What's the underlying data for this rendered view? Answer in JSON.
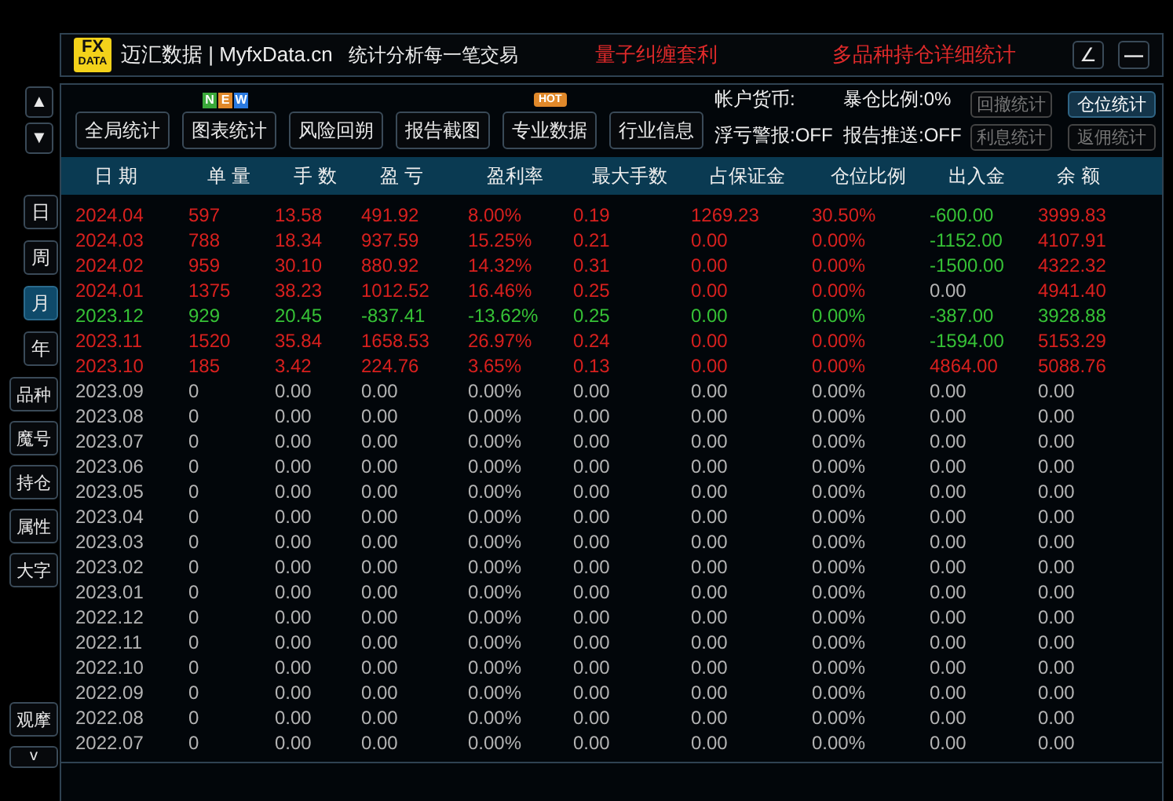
{
  "title_bar": {
    "logo": [
      "FX",
      "DATA"
    ],
    "brand": "迈汇数据 | MyfxData.cn",
    "slogan": "统计分析每一笔交易",
    "links": [
      "量子纠缠套利",
      "多品种持仓详细统计"
    ],
    "buttons": [
      "∠",
      "—"
    ]
  },
  "scroll_buttons": [
    "▲",
    "▼"
  ],
  "side_buttons": [
    {
      "label": "日",
      "selected": false
    },
    {
      "label": "周",
      "selected": false
    },
    {
      "label": "月",
      "selected": true
    },
    {
      "label": "年",
      "selected": false
    }
  ],
  "side_tools": [
    "品种",
    "魔号",
    "持仓",
    "属性",
    "大字"
  ],
  "side_bottom": [
    "观摩",
    "v"
  ],
  "toolbar": {
    "buttons": [
      {
        "label": "全局统计"
      },
      {
        "label": "图表统计",
        "badge": {
          "kind": "new",
          "letters": [
            "N",
            "E",
            "W"
          ]
        }
      },
      {
        "label": "风险回朔"
      },
      {
        "label": "报告截图"
      },
      {
        "label": "专业数据",
        "badge": {
          "kind": "hot",
          "text": "HOT"
        }
      },
      {
        "label": "行业信息"
      }
    ],
    "info": [
      "帐户货币:",
      "暴仓比例:0%",
      "浮亏警报:OFF",
      "报告推送:OFF"
    ],
    "stat_buttons": [
      {
        "label": "回撤统计",
        "selected": false
      },
      {
        "label": "仓位统计",
        "selected": true
      },
      {
        "label": "利息统计",
        "selected": false
      },
      {
        "label": "返佣统计",
        "selected": false
      }
    ]
  },
  "table": {
    "columns": [
      "日 期",
      "单 量",
      "手 数",
      "盈 亏",
      "盈利率",
      "最大手数",
      "占保证金",
      "仓位比例",
      "出入金",
      "余 额"
    ],
    "rows": [
      {
        "kind": "gain",
        "cells": [
          "2024.04",
          "597",
          "13.58",
          "491.92",
          "8.00%",
          "0.19",
          "1269.23",
          "30.50%"
        ],
        "cash": {
          "kind": "out",
          "text": "-600.00"
        },
        "balance": "3999.83"
      },
      {
        "kind": "gain",
        "cells": [
          "2024.03",
          "788",
          "18.34",
          "937.59",
          "15.25%",
          "0.21",
          "0.00",
          "0.00%"
        ],
        "cash": {
          "kind": "out",
          "text": "-1152.00"
        },
        "balance": "4107.91"
      },
      {
        "kind": "gain",
        "cells": [
          "2024.02",
          "959",
          "30.10",
          "880.92",
          "14.32%",
          "0.31",
          "0.00",
          "0.00%"
        ],
        "cash": {
          "kind": "out",
          "text": "-1500.00"
        },
        "balance": "4322.32"
      },
      {
        "kind": "gain",
        "cells": [
          "2024.01",
          "1375",
          "38.23",
          "1012.52",
          "16.46%",
          "0.25",
          "0.00",
          "0.00%"
        ],
        "cash": {
          "kind": "none",
          "text": "0.00"
        },
        "balance": "4941.40"
      },
      {
        "kind": "loss",
        "cells": [
          "2023.12",
          "929",
          "20.45",
          "-837.41",
          "-13.62%",
          "0.25",
          "0.00",
          "0.00%"
        ],
        "cash": {
          "kind": "out",
          "text": "-387.00"
        },
        "balance": "3928.88"
      },
      {
        "kind": "gain",
        "cells": [
          "2023.11",
          "1520",
          "35.84",
          "1658.53",
          "26.97%",
          "0.24",
          "0.00",
          "0.00%"
        ],
        "cash": {
          "kind": "out",
          "text": "-1594.00"
        },
        "balance": "5153.29"
      },
      {
        "kind": "gain",
        "cells": [
          "2023.10",
          "185",
          "3.42",
          "224.76",
          "3.65%",
          "0.13",
          "0.00",
          "0.00%"
        ],
        "cash": {
          "kind": "in",
          "text": "4864.00"
        },
        "balance": "5088.76"
      },
      {
        "kind": "empty",
        "cells": [
          "2023.09",
          "0",
          "0.00",
          "0.00",
          "0.00%",
          "0.00",
          "0.00",
          "0.00%"
        ],
        "cash": {
          "kind": "none",
          "text": "0.00"
        },
        "balance": "0.00"
      },
      {
        "kind": "empty",
        "cells": [
          "2023.08",
          "0",
          "0.00",
          "0.00",
          "0.00%",
          "0.00",
          "0.00",
          "0.00%"
        ],
        "cash": {
          "kind": "none",
          "text": "0.00"
        },
        "balance": "0.00"
      },
      {
        "kind": "empty",
        "cells": [
          "2023.07",
          "0",
          "0.00",
          "0.00",
          "0.00%",
          "0.00",
          "0.00",
          "0.00%"
        ],
        "cash": {
          "kind": "none",
          "text": "0.00"
        },
        "balance": "0.00"
      },
      {
        "kind": "empty",
        "cells": [
          "2023.06",
          "0",
          "0.00",
          "0.00",
          "0.00%",
          "0.00",
          "0.00",
          "0.00%"
        ],
        "cash": {
          "kind": "none",
          "text": "0.00"
        },
        "balance": "0.00"
      },
      {
        "kind": "empty",
        "cells": [
          "2023.05",
          "0",
          "0.00",
          "0.00",
          "0.00%",
          "0.00",
          "0.00",
          "0.00%"
        ],
        "cash": {
          "kind": "none",
          "text": "0.00"
        },
        "balance": "0.00"
      },
      {
        "kind": "empty",
        "cells": [
          "2023.04",
          "0",
          "0.00",
          "0.00",
          "0.00%",
          "0.00",
          "0.00",
          "0.00%"
        ],
        "cash": {
          "kind": "none",
          "text": "0.00"
        },
        "balance": "0.00"
      },
      {
        "kind": "empty",
        "cells": [
          "2023.03",
          "0",
          "0.00",
          "0.00",
          "0.00%",
          "0.00",
          "0.00",
          "0.00%"
        ],
        "cash": {
          "kind": "none",
          "text": "0.00"
        },
        "balance": "0.00"
      },
      {
        "kind": "empty",
        "cells": [
          "2023.02",
          "0",
          "0.00",
          "0.00",
          "0.00%",
          "0.00",
          "0.00",
          "0.00%"
        ],
        "cash": {
          "kind": "none",
          "text": "0.00"
        },
        "balance": "0.00"
      },
      {
        "kind": "empty",
        "cells": [
          "2023.01",
          "0",
          "0.00",
          "0.00",
          "0.00%",
          "0.00",
          "0.00",
          "0.00%"
        ],
        "cash": {
          "kind": "none",
          "text": "0.00"
        },
        "balance": "0.00"
      },
      {
        "kind": "empty",
        "cells": [
          "2022.12",
          "0",
          "0.00",
          "0.00",
          "0.00%",
          "0.00",
          "0.00",
          "0.00%"
        ],
        "cash": {
          "kind": "none",
          "text": "0.00"
        },
        "balance": "0.00"
      },
      {
        "kind": "empty",
        "cells": [
          "2022.11",
          "0",
          "0.00",
          "0.00",
          "0.00%",
          "0.00",
          "0.00",
          "0.00%"
        ],
        "cash": {
          "kind": "none",
          "text": "0.00"
        },
        "balance": "0.00"
      },
      {
        "kind": "empty",
        "cells": [
          "2022.10",
          "0",
          "0.00",
          "0.00",
          "0.00%",
          "0.00",
          "0.00",
          "0.00%"
        ],
        "cash": {
          "kind": "none",
          "text": "0.00"
        },
        "balance": "0.00"
      },
      {
        "kind": "empty",
        "cells": [
          "2022.09",
          "0",
          "0.00",
          "0.00",
          "0.00%",
          "0.00",
          "0.00",
          "0.00%"
        ],
        "cash": {
          "kind": "none",
          "text": "0.00"
        },
        "balance": "0.00"
      },
      {
        "kind": "empty",
        "cells": [
          "2022.08",
          "0",
          "0.00",
          "0.00",
          "0.00%",
          "0.00",
          "0.00",
          "0.00%"
        ],
        "cash": {
          "kind": "none",
          "text": "0.00"
        },
        "balance": "0.00"
      },
      {
        "kind": "empty",
        "cells": [
          "2022.07",
          "0",
          "0.00",
          "0.00",
          "0.00%",
          "0.00",
          "0.00",
          "0.00%"
        ],
        "cash": {
          "kind": "none",
          "text": "0.00"
        },
        "balance": "0.00"
      }
    ]
  }
}
